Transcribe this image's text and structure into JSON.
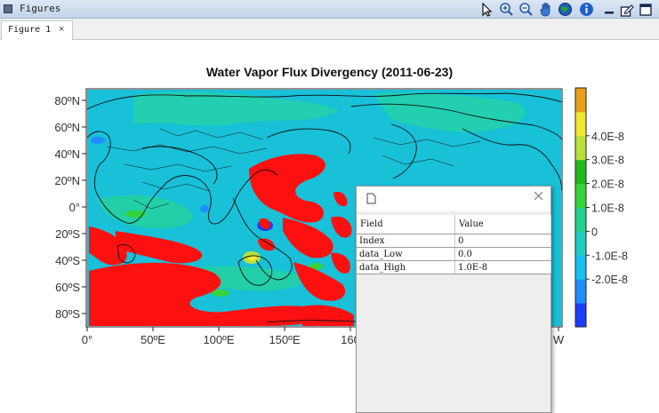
{
  "window": {
    "title": "Figures"
  },
  "toolbar": {
    "buttons": [
      {
        "name": "select-pointer-icon"
      },
      {
        "name": "zoom-in-icon"
      },
      {
        "name": "zoom-out-icon"
      },
      {
        "name": "pan-hand-icon"
      },
      {
        "name": "globe-icon"
      },
      {
        "name": "info-icon"
      },
      {
        "name": "minimize-icon"
      },
      {
        "name": "edit-document-icon"
      },
      {
        "name": "restore-icon"
      }
    ]
  },
  "tabs": [
    {
      "label": "Figure 1",
      "close": "×"
    }
  ],
  "chart_data": {
    "type": "heatmap",
    "title": "Water Vapor Flux Divergency (2011-06-23)",
    "x_ticks": [
      "0°",
      "50ºE",
      "100ºE",
      "150ºE",
      "160",
      "W"
    ],
    "y_ticks": [
      "80ºN",
      "60ºN",
      "40ºN",
      "20ºN",
      "0°",
      "20ºS",
      "40ºS",
      "60ºS",
      "80ºS"
    ],
    "colorbar": {
      "levels": [
        "-3.0E-8",
        "-2.0E-8",
        "-1.0E-8",
        "0",
        "1.0E-8",
        "2.0E-8",
        "3.0E-8",
        "4.0E-8",
        "5.0E-8"
      ],
      "tick_labels": [
        "4.0E-8",
        "3.0E-8",
        "2.0E-8",
        "1.0E-8",
        "0",
        "-1.0E-8",
        "-2.0E-8"
      ],
      "colors": [
        "#1c3cff",
        "#1f8cff",
        "#18c0ee",
        "#20ccc0",
        "#22d090",
        "#35d43c",
        "#22b81e",
        "#b8e03c",
        "#f0e830",
        "#e8a01c"
      ]
    }
  },
  "popup": {
    "headers": [
      "Field",
      "Value"
    ],
    "rows": [
      [
        "Index",
        "0"
      ],
      [
        "data_Low",
        "0.0"
      ],
      [
        "data_High",
        "1.0E-8"
      ]
    ]
  }
}
